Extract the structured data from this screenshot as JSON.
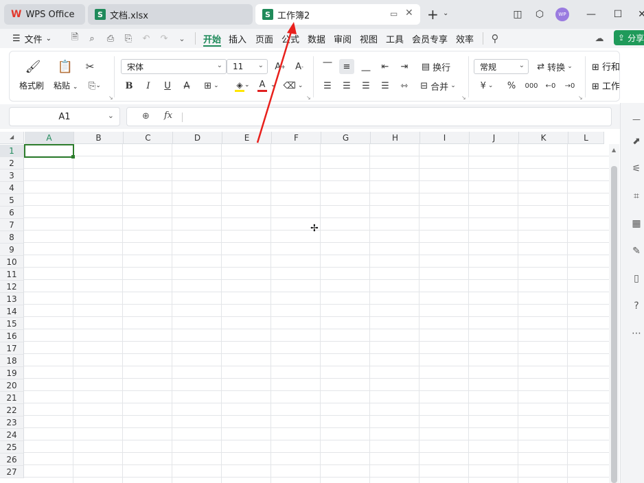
{
  "tabs": [
    {
      "label": "WPS Office",
      "state": "inactive",
      "icon": "wps-logo-icon"
    },
    {
      "label": "文档.xlsx",
      "state": "inactive",
      "icon": "spreadsheet-icon"
    },
    {
      "label": "工作簿2",
      "state": "active",
      "icon": "spreadsheet-icon"
    }
  ],
  "user": {
    "initials": "WP"
  },
  "menubar": {
    "file_label": "文件",
    "items": [
      "开始",
      "插入",
      "页面",
      "公式",
      "数据",
      "审阅",
      "视图",
      "工具",
      "会员专享",
      "效率"
    ],
    "active": "开始",
    "share_label": "分享"
  },
  "ribbon": {
    "format_painter": "格式刷",
    "paste": "粘贴",
    "font_name": "宋体",
    "font_size": "11",
    "wrap_text": "换行",
    "merge": "合并",
    "number_format": "常规",
    "convert": "转换",
    "rows_cols": "行和列",
    "worksheet": "工作表",
    "bold": "B",
    "italic": "I",
    "underline": "U",
    "strike": "A",
    "currency": "¥",
    "percent": "%",
    "thousands": "000",
    "dec_increase": "←0",
    "dec_decrease": "→0",
    "font_color": "#e02020",
    "fill_color": "#ffe600"
  },
  "formula_bar": {
    "name_box": "A1",
    "fx_label": "fx",
    "value": ""
  },
  "sheet": {
    "columns": [
      "A",
      "B",
      "C",
      "D",
      "E",
      "F",
      "G",
      "H",
      "I",
      "J",
      "K",
      "L"
    ],
    "rows": [
      "1",
      "2",
      "3",
      "4",
      "5",
      "6",
      "7",
      "8",
      "9",
      "10",
      "11",
      "12",
      "13",
      "14",
      "15",
      "16",
      "17",
      "18",
      "19",
      "20",
      "21",
      "22",
      "23",
      "24",
      "25",
      "26",
      "27"
    ],
    "selected_cell": "A1"
  },
  "colors": {
    "accent": "#1f8a5a",
    "annotation_arrow": "#e8201c",
    "selection": "#2c7d2c"
  }
}
